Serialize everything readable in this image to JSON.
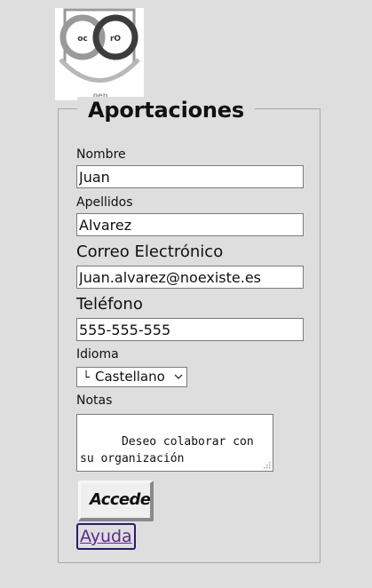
{
  "logo": {
    "letters_left": "oc",
    "letters_right": "rO",
    "caption": "pen"
  },
  "form": {
    "legend": "Aportaciones",
    "nombre": {
      "label": "Nombre",
      "value": "Juan"
    },
    "apellidos": {
      "label": "Apellidos",
      "value": "Alvarez"
    },
    "correo": {
      "label": "Correo Electrónico",
      "value": "Juan.alvarez@noexiste.es"
    },
    "telefono": {
      "label": "Teléfono",
      "value": "555-555-555"
    },
    "idioma": {
      "label": "Idioma",
      "prefix": "└",
      "selected": "Castellano"
    },
    "notas": {
      "label": "Notas",
      "value": "Deseo colaborar con su organización"
    },
    "submit_label": "Acceder",
    "help_link": "Ayuda"
  },
  "colors": {
    "page_background": "#dedede",
    "link": "#5b2a8c",
    "focus_border": "#2a1a6e"
  }
}
